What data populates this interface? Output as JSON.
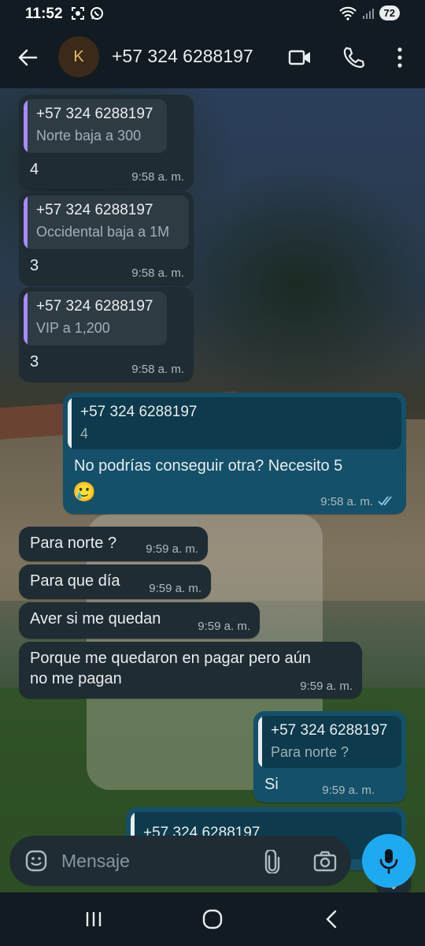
{
  "status_bar": {
    "time": "11:52",
    "battery": "72",
    "icons": [
      "screenshot-icon",
      "whatsapp-icon",
      "wifi-icon",
      "signal-icon"
    ]
  },
  "header": {
    "avatar_letter": "K",
    "contact_name": "+57 324 6288197",
    "icons": [
      "back-arrow-icon",
      "video-call-icon",
      "phone-call-icon",
      "more-vert-icon"
    ]
  },
  "colors": {
    "incoming": "#1f2c33",
    "outgoing": "#145069",
    "quote_bar_in": "#a78bfa",
    "quote_bar_out": "#e9edef",
    "header_bg": "#111b21",
    "mic_button": "#1eaaf1"
  },
  "messages": [
    {
      "dir": "in",
      "quote_name": "+57 324 6288197",
      "quote_text": "Norte baja a 300",
      "text": "4",
      "time": "9:58 a. m."
    },
    {
      "dir": "in",
      "quote_name": "+57 324 6288197",
      "quote_text": "Occidental baja a 1M",
      "text": "3",
      "time": "9:58 a. m."
    },
    {
      "dir": "in",
      "quote_name": "+57 324 6288197",
      "quote_text": "VIP a 1,200",
      "text": "3",
      "time": "9:58 a. m."
    },
    {
      "dir": "out",
      "quote_name": "+57 324 6288197",
      "quote_text": "4",
      "text": "No podrías conseguir otra? Necesito 5",
      "emoji": "🥲",
      "time": "9:58 a. m.",
      "status": "read"
    },
    {
      "dir": "in",
      "text": "Para norte ?",
      "time": "9:59 a. m."
    },
    {
      "dir": "in",
      "text": "Para que día",
      "time": "9:59 a. m."
    },
    {
      "dir": "in",
      "text": "Aver si me quedan",
      "time": "9:59 a. m."
    },
    {
      "dir": "in",
      "text_line1": "Porque me quedaron en pagar pero aún",
      "text_line2": "no me pagan",
      "time": "9:59 a. m."
    },
    {
      "dir": "out",
      "quote_name": "+57 324 6288197",
      "quote_text": "Para norte ?",
      "text": "Si",
      "time": "9:59 a. m."
    },
    {
      "dir": "out",
      "quote_name": "+57 324 6288197",
      "partial": true
    }
  ],
  "composer": {
    "placeholder": "Mensaje",
    "icons": [
      "emoji-icon",
      "attach-icon",
      "camera-icon",
      "mic-icon"
    ]
  },
  "nav_bar": {
    "icons": [
      "recents-icon",
      "home-icon",
      "back-icon"
    ]
  }
}
